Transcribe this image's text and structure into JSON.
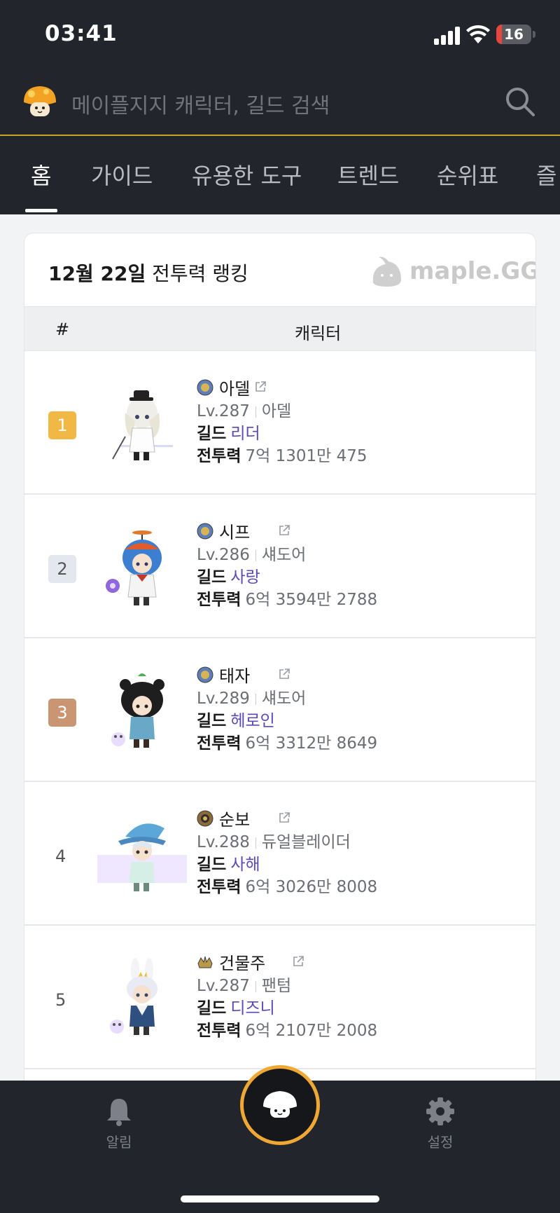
{
  "status_bar": {
    "time": "03:41",
    "battery": "16",
    "battery_level": 0.16
  },
  "search": {
    "placeholder": "메이플지지 캐릭터, 길드 검색",
    "logo_icon": "mushroom-logo-icon",
    "search_icon": "search-icon"
  },
  "tabs": [
    {
      "label": "홈",
      "active": true
    },
    {
      "label": "가이드"
    },
    {
      "label": "유용한 도구"
    },
    {
      "label": "트렌드"
    },
    {
      "label": "순위표"
    },
    {
      "label": "즐"
    }
  ],
  "ranking": {
    "date_label": "12월 22일",
    "title_suffix": "전투력 랭킹",
    "brand": "maple.GG",
    "header": {
      "rank": "#",
      "character": "캐릭터"
    },
    "labels": {
      "guild": "길드",
      "power": "전투력"
    },
    "rows": [
      {
        "rank": "1",
        "badge_color": "#f2b846",
        "name": "아델",
        "level": "Lv.287",
        "job": "아델",
        "guild": "리더",
        "power": "7억 1301만 475"
      },
      {
        "rank": "2",
        "badge_color": "#e3e7ee",
        "name": "시프",
        "level": "Lv.286",
        "job": "섀도어",
        "guild": "사랑",
        "power": "6억 3594만 2788"
      },
      {
        "rank": "3",
        "badge_color": "#c99572",
        "name": "태자",
        "level": "Lv.289",
        "job": "섀도어",
        "guild": "헤로인",
        "power": "6억 3312만 8649"
      },
      {
        "rank": "4",
        "name": "순보",
        "level": "Lv.288",
        "job": "듀얼블레이더",
        "guild": "사해",
        "power": "6억 3026만 8008"
      },
      {
        "rank": "5",
        "name": "건물주",
        "level": "Lv.287",
        "job": "팬텀",
        "guild": "디즈니",
        "power": "6억 2107만 2008"
      }
    ]
  },
  "bottom_nav": {
    "alerts": {
      "label": "알림",
      "icon": "bell-icon"
    },
    "center": {
      "icon": "mushroom-home-icon"
    },
    "settings": {
      "label": "설정",
      "icon": "gear-icon"
    }
  }
}
